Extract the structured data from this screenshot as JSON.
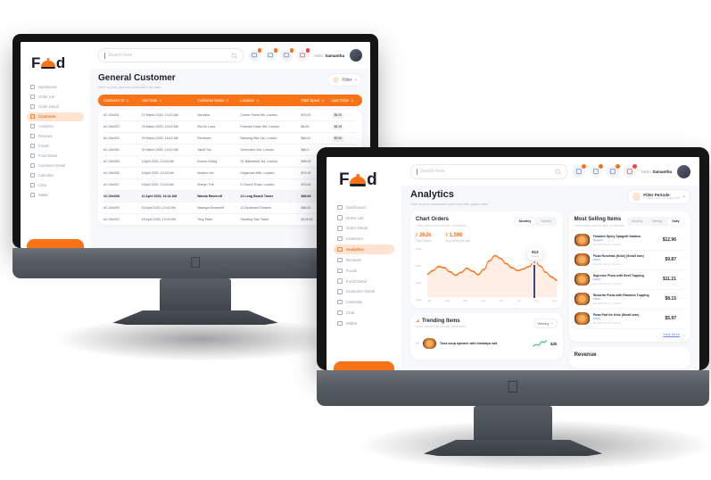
{
  "brand": {
    "name": "Food",
    "accent": "#f97316",
    "active_bg": "#fde3d0",
    "link": "#5b8def"
  },
  "screen1": {
    "sidebar": {
      "logo": "Food",
      "items": [
        {
          "label": "Dashboard",
          "icon": "grid-icon",
          "active": false
        },
        {
          "label": "Order List",
          "icon": "list-icon",
          "active": false
        },
        {
          "label": "Order Detail",
          "icon": "document-icon",
          "active": false
        },
        {
          "label": "Customer",
          "icon": "user-icon",
          "active": true
        },
        {
          "label": "Analytics",
          "icon": "chart-icon",
          "active": false
        },
        {
          "label": "Reviews",
          "icon": "star-icon",
          "active": false
        },
        {
          "label": "Foods",
          "icon": "bowl-icon",
          "active": false
        },
        {
          "label": "Food Detail",
          "icon": "burger-icon",
          "active": false
        },
        {
          "label": "Customer Detail",
          "icon": "person-icon",
          "active": false
        },
        {
          "label": "Calendar",
          "icon": "calendar-icon",
          "active": false
        },
        {
          "label": "Chat",
          "icon": "chat-icon",
          "active": false
        },
        {
          "label": "Wallet",
          "icon": "wallet-icon",
          "active": false
        }
      ]
    },
    "topbar": {
      "search_placeholder": "Search here",
      "search_icon": "search-icon",
      "icons": [
        {
          "name": "mail-icon",
          "badge": "2",
          "color": "#eef4ff",
          "badge_color": "#f97316"
        },
        {
          "name": "chat-icon",
          "badge": "5",
          "color": "#eef9f6",
          "badge_color": "#f97316"
        },
        {
          "name": "cart-icon",
          "badge": "8",
          "color": "#f3f1fd",
          "badge_color": "#f97316"
        },
        {
          "name": "bell-icon",
          "badge": "9",
          "color": "#ffeff0",
          "badge_color": "#ef4444"
        }
      ],
      "greeting": "Hello, ",
      "user": "Samantha",
      "avatar": "avatar"
    },
    "header": {
      "title": "General Customer",
      "subtitle": "Here is your general customers list data",
      "filter_label": "Filter"
    },
    "table": {
      "columns": [
        "Customer ID",
        "Join Date",
        "Customer Name",
        "Location",
        "Total Spent",
        "Last Order"
      ],
      "rows": [
        {
          "id": "#C-00x001",
          "date": "27 March 2020, 13:42 AM",
          "name": "Veronika",
          "loc": "Corner Street 5th, London",
          "spent": "$76.62",
          "last": "$8.25"
        },
        {
          "id": "#C-00x002",
          "date": "29 March 2020, 13:42 AM",
          "name": "Ria De Luna",
          "loc": "Emerald Tower 5th, London",
          "spent": "$8.80",
          "last": "$8.15"
        },
        {
          "id": "#C-00x003",
          "date": "29 March 2020, 13:42 AM",
          "name": "Fernando",
          "loc": "Blessing Hills 1st, London",
          "spent": "$66.67",
          "last": "$9.06"
        },
        {
          "id": "#C-00x004",
          "date": "30 March 2020, 13:42 AM",
          "name": "Yandi Tan",
          "loc": "Greenland 2nd, London",
          "spent": "$66.4",
          "last": "$6.85"
        },
        {
          "id": "#C-00x005",
          "date": "5 April 2020, 13:43 AM",
          "name": "Donna Chang",
          "loc": "St. Bakerfried 3rd, London",
          "spent": "$98.92",
          "last": "$8.20"
        },
        {
          "id": "#C-00x006",
          "date": "8 April 2020, 13:43 AM",
          "name": "Andrea Lee",
          "loc": "Kingsroad 48th, London",
          "spent": "$74.92",
          "last": "$7.10"
        },
        {
          "id": "#C-00x007",
          "date": "8 April 2020, 13:43 AM",
          "name": "Sheryn The",
          "loc": "9 Church Road, London",
          "spent": "$76.62",
          "last": "$9.35"
        },
        {
          "id": "#C-00x008",
          "date": "11 April 2020, 13:42 AM",
          "name": "Wanda Ravenoff",
          "loc": "21 Long Beach Tower",
          "spent": "$88.83",
          "last": "$8.15"
        },
        {
          "id": "#C-00x009",
          "date": "15 April 2020, 13:43 AM",
          "name": "Natanya Romanoff",
          "loc": "12 Boulevard Dreams",
          "spent": "$86.62",
          "last": "$7.62"
        },
        {
          "id": "#C-00x010",
          "date": "18 April 2020, 13:43 AM",
          "name": "Tony Stark",
          "loc": "Sandboy San Tower",
          "spent": "$124.62",
          "last": "$9.85"
        }
      ],
      "row_menu_icon": "more-icon"
    }
  },
  "screen2": {
    "sidebar": {
      "logo": "Food",
      "items": [
        {
          "label": "Dashboard",
          "icon": "grid-icon",
          "active": false
        },
        {
          "label": "Order List",
          "icon": "list-icon",
          "active": false
        },
        {
          "label": "Order Detail",
          "icon": "document-icon",
          "active": false
        },
        {
          "label": "Customer",
          "icon": "user-icon",
          "active": false
        },
        {
          "label": "Analytics",
          "icon": "chart-icon",
          "active": true
        },
        {
          "label": "Reviews",
          "icon": "star-icon",
          "active": false
        },
        {
          "label": "Foods",
          "icon": "bowl-icon",
          "active": false
        },
        {
          "label": "Food Detail",
          "icon": "burger-icon",
          "active": false
        },
        {
          "label": "Customer Detail",
          "icon": "person-icon",
          "active": false
        },
        {
          "label": "Calendar",
          "icon": "calendar-icon",
          "active": false
        },
        {
          "label": "Chat",
          "icon": "chat-icon",
          "active": false
        },
        {
          "label": "Wallet",
          "icon": "wallet-icon",
          "active": false
        }
      ]
    },
    "topbar": {
      "search_placeholder": "Search here",
      "search_icon": "search-icon",
      "icons": [
        {
          "name": "mail-icon",
          "badge": "2",
          "color": "#eef4ff",
          "badge_color": "#f97316"
        },
        {
          "name": "chat-icon",
          "badge": "5",
          "color": "#eef9f6",
          "badge_color": "#f97316"
        },
        {
          "name": "cart-icon",
          "badge": "8",
          "color": "#f3f1fd",
          "badge_color": "#f97316"
        },
        {
          "name": "bell-icon",
          "badge": "9",
          "color": "#ffeff0",
          "badge_color": "#ef4444"
        }
      ],
      "greeting": "Hello, ",
      "user": "Samantha",
      "avatar": "avatar"
    },
    "header": {
      "title": "Analytics",
      "subtitle": "Here is your restaurant summary with graph view",
      "filter_label": "Filter Periode",
      "filter_sub": "17 April 2020 - 21 May 2020"
    },
    "chart_card": {
      "title": "Chart Orders",
      "subtitle": "Lorem ipsum dolor sit amet, consectetur",
      "tabs": [
        {
          "label": "Monthly",
          "active": true
        },
        {
          "label": "Weekly",
          "active": false
        }
      ],
      "kpis": [
        {
          "value": "262k",
          "label": "Total Orders",
          "icon": "bars-icon"
        },
        {
          "value": "1,596",
          "label": "Avg Orders per day",
          "icon": "bars-icon"
        }
      ],
      "tooltip": {
        "value": "612",
        "label": "Orders"
      }
    },
    "trending": {
      "title": "Trending Items",
      "subtitle": "Lorem ipsum dolor sit amet, consectetur",
      "icon": "fire-icon",
      "period": "Weekly",
      "rows": [
        {
          "rank": "#1",
          "name": "Tuna soup spinach with himalaya salt",
          "value": "$2k",
          "spark": "sparkline-icon"
        }
      ]
    },
    "selling": {
      "title": "Most Selling Items",
      "subtitle": "Lorem ipsum dolor sit amet, consectetur",
      "tabs": [
        {
          "label": "Monthly",
          "active": false
        },
        {
          "label": "Weekly",
          "active": false
        },
        {
          "label": "Daily",
          "active": true
        }
      ],
      "items": [
        {
          "name": "Fondant Spicy Spagetti Italiano",
          "cat": "Spagetti",
          "meta": "Standard Dinner  |  Cheese",
          "price": "$12.96"
        },
        {
          "name": "Pizza Rosettas (Kids) (Small size)",
          "cat": "PIZZA",
          "meta": "Standard Dinner  |  Cheese",
          "price": "$9.87"
        },
        {
          "name": "Supreme Pizza with Beef Topping",
          "cat": "PIZZA",
          "meta": "Standard Dinner  |  Cheese",
          "price": "$11.21"
        },
        {
          "name": "Rosarito Pizza with Random Topping",
          "cat": "PIZZA",
          "meta": "Standard Dinner  |  Cheese",
          "price": "$8.15"
        },
        {
          "name": "Pizza Pad for Kids (Small size)",
          "cat": "PIZZA",
          "meta": "Standard Dinner  |  Cheese",
          "price": "$5.97"
        }
      ],
      "view_more": "View More"
    },
    "revenue": {
      "title": "Revenue"
    }
  },
  "chart_data": {
    "type": "area",
    "title": "Chart Orders",
    "xlabel": "",
    "ylabel": "Orders",
    "categories": [
      "Jan",
      "Feb",
      "Mar",
      "Apr",
      "Jun",
      "Jul",
      "Aug",
      "Sep"
    ],
    "tick_labels": [
      "100k",
      "200k",
      "300k",
      "400k"
    ],
    "ylim": [
      0,
      400
    ],
    "grid": false,
    "legend": "none",
    "x": [
      0,
      1,
      2,
      3,
      4,
      5,
      6,
      7,
      8,
      9,
      10,
      11,
      12,
      13,
      14,
      15,
      16,
      17,
      18,
      19,
      20,
      21,
      22,
      23
    ],
    "values": [
      185,
      215,
      250,
      240,
      205,
      175,
      200,
      235,
      210,
      180,
      225,
      300,
      345,
      320,
      275,
      240,
      215,
      230,
      250,
      300,
      255,
      200,
      160,
      130
    ],
    "highlight": {
      "x": 19,
      "value": 300,
      "tooltip_value": "612",
      "tooltip_label": "Orders"
    },
    "series_color": "#f97316",
    "fill": "rgba(249,115,22,0.10)"
  }
}
